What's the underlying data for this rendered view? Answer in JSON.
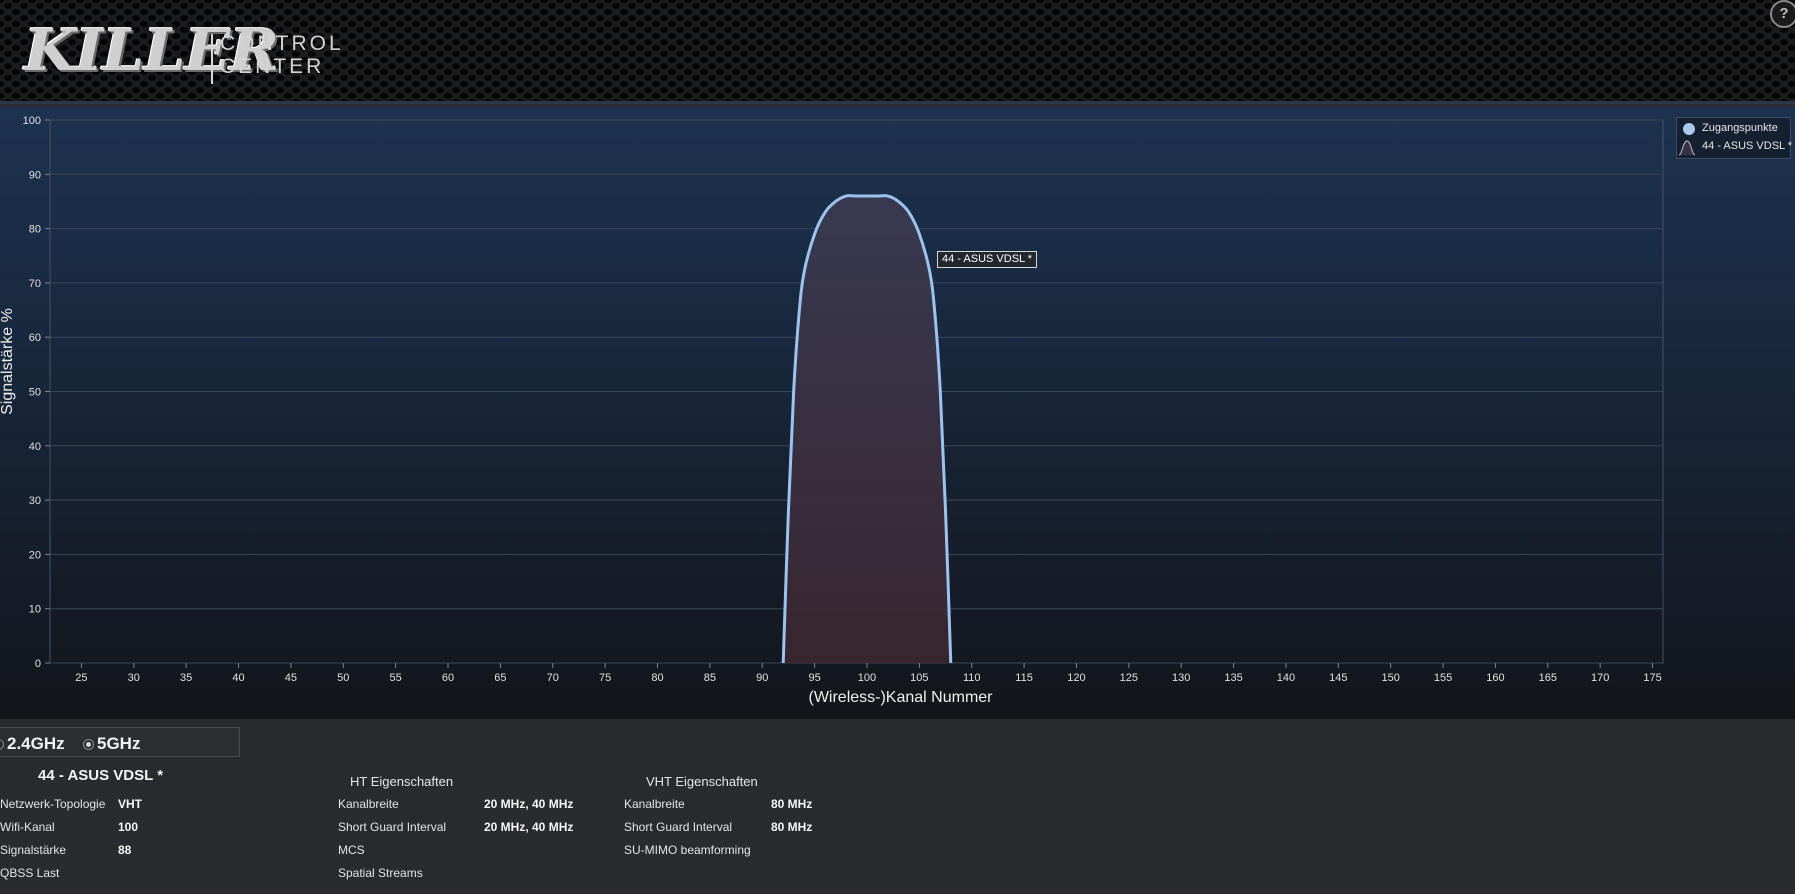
{
  "header": {
    "logo_word": "KILLER",
    "logo_line1": "CONTROL",
    "logo_line2": "CENTER",
    "help_label": "?"
  },
  "colors": {
    "curve_stroke": "#9cc3ef",
    "curve_fill_top": "#3a3a52",
    "curve_fill_bottom": "#3b2730",
    "grid": "#3b4655",
    "legend_dot": "#a8c8ee"
  },
  "legend": {
    "items": [
      {
        "label": "Zugangspunkte",
        "icon": "circle-dot-icon"
      },
      {
        "label": "44 - ASUS VDSL *",
        "icon": "bell-curve-icon"
      }
    ]
  },
  "tooltip": {
    "text": "44 - ASUS VDSL *"
  },
  "chart_data": {
    "type": "area",
    "xlabel": "(Wireless-)Kanal Nummer",
    "ylabel": "Signalstärke %",
    "xlim": [
      22,
      176
    ],
    "ylim": [
      0,
      100
    ],
    "x_ticks": [
      25,
      30,
      35,
      40,
      45,
      50,
      55,
      60,
      65,
      70,
      75,
      80,
      85,
      90,
      95,
      100,
      105,
      110,
      115,
      120,
      125,
      130,
      135,
      140,
      145,
      150,
      155,
      160,
      165,
      170,
      175
    ],
    "y_ticks": [
      0,
      10,
      20,
      30,
      40,
      50,
      60,
      70,
      80,
      90,
      100
    ],
    "grid": true,
    "legend_position": "top-right",
    "series": [
      {
        "name": "44 - ASUS VDSL *",
        "x": [
          92,
          92.5,
          93,
          93.5,
          94,
          95,
          96,
          97,
          98,
          99,
          100,
          101,
          102,
          103,
          104,
          105,
          106,
          106.5,
          107,
          107.5,
          108
        ],
        "y": [
          0,
          28,
          50,
          64,
          72,
          79,
          83,
          85,
          86,
          86,
          86,
          86,
          86,
          85,
          83,
          79,
          72,
          64,
          50,
          28,
          0
        ]
      }
    ]
  },
  "band": {
    "options": [
      {
        "label": "2.4GHz",
        "checked": false
      },
      {
        "label": "5GHz",
        "checked": true
      }
    ]
  },
  "network": {
    "name": "44 - ASUS VDSL *",
    "props": [
      {
        "label": "Netzwerk-Topologie",
        "value": "VHT"
      },
      {
        "label": "Wifi-Kanal",
        "value": "100"
      },
      {
        "label": "Signalstärke",
        "value": "88"
      },
      {
        "label": "QBSS Last",
        "value": ""
      }
    ]
  },
  "ht": {
    "title": "HT Eigenschaften",
    "props": [
      {
        "label": "Kanalbreite",
        "value": "20 MHz, 40 MHz"
      },
      {
        "label": "Short Guard Interval",
        "value": "20 MHz, 40 MHz"
      },
      {
        "label": "MCS",
        "value": ""
      },
      {
        "label": "Spatial Streams",
        "value": ""
      }
    ]
  },
  "vht": {
    "title": "VHT Eigenschaften",
    "props": [
      {
        "label": "Kanalbreite",
        "value": "80 MHz"
      },
      {
        "label": "Short Guard Interval",
        "value": "80 MHz"
      },
      {
        "label": "SU-MIMO beamforming",
        "value": ""
      }
    ]
  }
}
